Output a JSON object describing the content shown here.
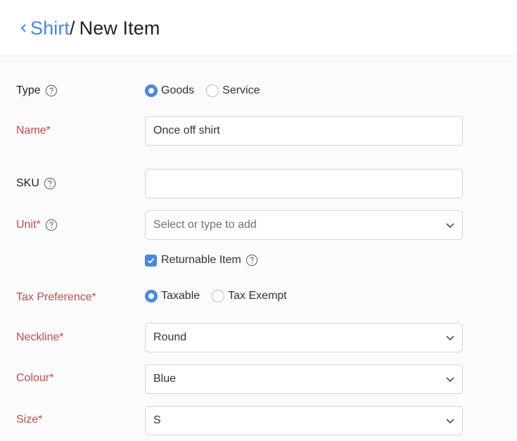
{
  "header": {
    "breadcrumb_link": "Shirt",
    "separator": "/",
    "current": "New Item"
  },
  "form": {
    "type": {
      "label": "Type",
      "options": [
        "Goods",
        "Service"
      ],
      "selected": "Goods"
    },
    "name": {
      "label": "Name*",
      "value": "Once off shirt"
    },
    "sku": {
      "label": "SKU",
      "value": ""
    },
    "unit": {
      "label": "Unit*",
      "placeholder": "Select or type to add"
    },
    "returnable": {
      "label": "Returnable Item",
      "checked": true
    },
    "tax_preference": {
      "label": "Tax Preference*",
      "options": [
        "Taxable",
        "Tax Exempt"
      ],
      "selected": "Taxable"
    },
    "neckline": {
      "label": "Neckline*",
      "value": "Round"
    },
    "colour": {
      "label": "Colour*",
      "value": "Blue"
    },
    "size": {
      "label": "Size*",
      "value": "S"
    }
  },
  "icons": {
    "back": "chevron-left-icon",
    "help": "question-circle-icon",
    "dropdown": "chevron-down-icon",
    "check": "checkmark-icon"
  },
  "colors": {
    "accent": "#4a86e8",
    "required_label": "#c64a4a",
    "border": "#d3d5dc"
  }
}
